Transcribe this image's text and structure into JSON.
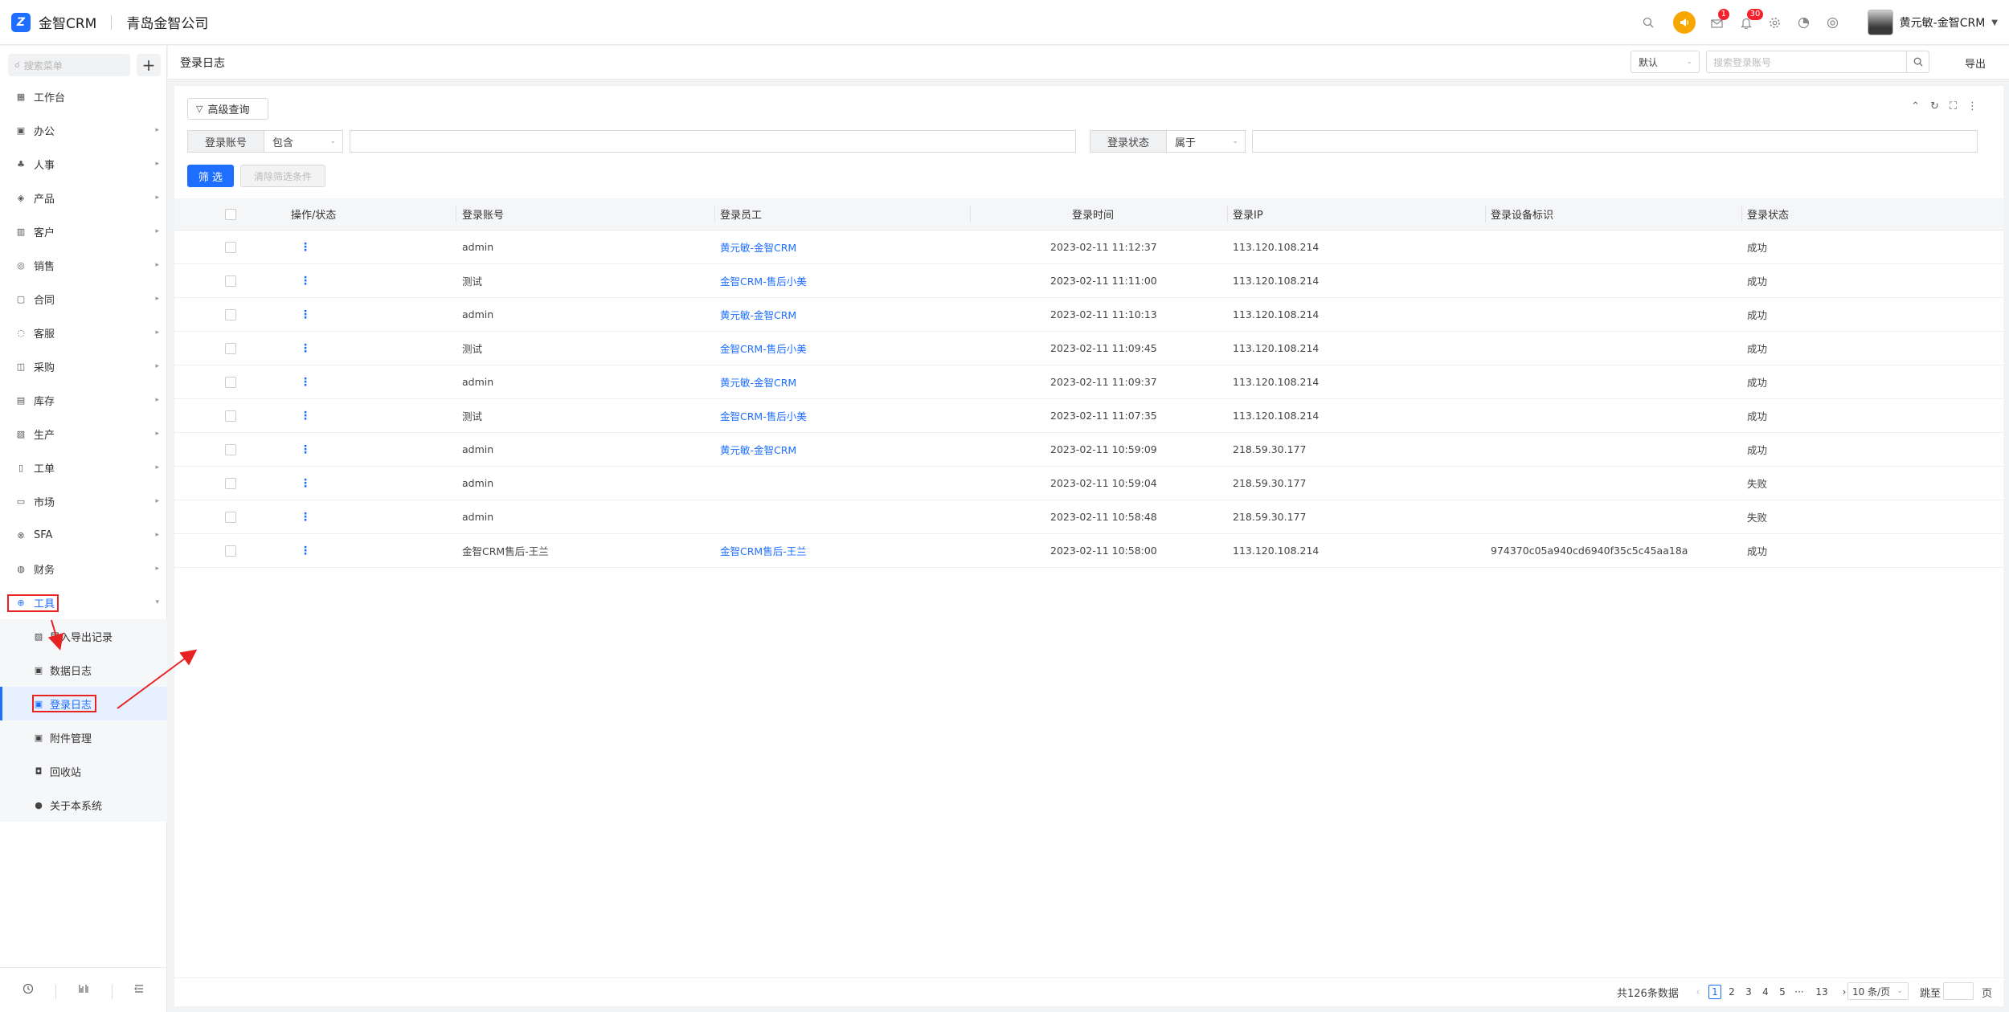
{
  "topbar": {
    "logo_glyph": "Z",
    "app_name": "金智CRM",
    "company": "青岛金智公司",
    "icons": [
      "search-icon",
      "speaker-icon",
      "mail-icon",
      "bell-icon",
      "gear-icon",
      "chart-icon",
      "help-icon"
    ],
    "mail_badge": "1",
    "bell_badge": "30",
    "user_name": "黄元敏-金智CRM"
  },
  "sidebar": {
    "search_placeholder": "搜索菜单",
    "add_label": "+",
    "items": [
      {
        "label": "工作台",
        "icon": "▦",
        "arrow": ""
      },
      {
        "label": "办公",
        "icon": "▣",
        "arrow": "▸"
      },
      {
        "label": "人事",
        "icon": "♣",
        "arrow": "▸"
      },
      {
        "label": "产品",
        "icon": "◈",
        "arrow": "▸"
      },
      {
        "label": "客户",
        "icon": "▥",
        "arrow": "▸"
      },
      {
        "label": "销售",
        "icon": "◎",
        "arrow": "▸"
      },
      {
        "label": "合同",
        "icon": "▢",
        "arrow": "▸"
      },
      {
        "label": "客服",
        "icon": "◌",
        "arrow": "▸"
      },
      {
        "label": "采购",
        "icon": "◫",
        "arrow": "▸"
      },
      {
        "label": "库存",
        "icon": "▤",
        "arrow": "▸"
      },
      {
        "label": "生产",
        "icon": "▧",
        "arrow": "▸"
      },
      {
        "label": "工单",
        "icon": "▯",
        "arrow": "▸"
      },
      {
        "label": "市场",
        "icon": "▭",
        "arrow": "▸"
      },
      {
        "label": "SFA",
        "icon": "⊗",
        "arrow": "▸"
      },
      {
        "label": "财务",
        "icon": "◍",
        "arrow": "▸"
      },
      {
        "label": "工具",
        "icon": "⊕",
        "arrow": "▾"
      }
    ],
    "sub_items": [
      {
        "label": "导入导出记录",
        "icon": "▨"
      },
      {
        "label": "数据日志",
        "icon": "▣"
      },
      {
        "label": "登录日志",
        "icon": "▣"
      },
      {
        "label": "附件管理",
        "icon": "▣"
      },
      {
        "label": "回收站",
        "icon": "◘"
      },
      {
        "label": "关于本系统",
        "icon": "●"
      }
    ],
    "bottom_icons": [
      "history-icon",
      "columns-icon",
      "collapse-menu-icon"
    ]
  },
  "page_head": {
    "title": "登录日志",
    "view_select": "默认",
    "search_placeholder": "搜索登录账号",
    "export_label": "导出"
  },
  "filters": {
    "advanced_label": "高级查询",
    "account_label": "登录账号",
    "account_op": "包含",
    "account_value": "",
    "status_label": "登录状态",
    "status_op": "属于",
    "status_value": "",
    "filter_btn": "筛 选",
    "clear_btn": "清除筛选条件",
    "tool_icons": [
      "collapse-icon",
      "refresh-icon",
      "fullscreen-icon",
      "more-icon"
    ]
  },
  "table": {
    "columns": [
      "操作/状态",
      "登录账号",
      "登录员工",
      "登录时间",
      "登录IP",
      "登录设备标识",
      "登录状态"
    ],
    "rows": [
      {
        "account": "admin",
        "employee": "黄元敏-金智CRM",
        "time": "2023-02-11 11:12:37",
        "ip": "113.120.108.214",
        "device": "",
        "status": "成功"
      },
      {
        "account": "测试",
        "employee": "金智CRM-售后小美",
        "time": "2023-02-11 11:11:00",
        "ip": "113.120.108.214",
        "device": "",
        "status": "成功"
      },
      {
        "account": "admin",
        "employee": "黄元敏-金智CRM",
        "time": "2023-02-11 11:10:13",
        "ip": "113.120.108.214",
        "device": "",
        "status": "成功"
      },
      {
        "account": "测试",
        "employee": "金智CRM-售后小美",
        "time": "2023-02-11 11:09:45",
        "ip": "113.120.108.214",
        "device": "",
        "status": "成功"
      },
      {
        "account": "admin",
        "employee": "黄元敏-金智CRM",
        "time": "2023-02-11 11:09:37",
        "ip": "113.120.108.214",
        "device": "",
        "status": "成功"
      },
      {
        "account": "测试",
        "employee": "金智CRM-售后小美",
        "time": "2023-02-11 11:07:35",
        "ip": "113.120.108.214",
        "device": "",
        "status": "成功"
      },
      {
        "account": "admin",
        "employee": "黄元敏-金智CRM",
        "time": "2023-02-11 10:59:09",
        "ip": "218.59.30.177",
        "device": "",
        "status": "成功"
      },
      {
        "account": "admin",
        "employee": "",
        "time": "2023-02-11 10:59:04",
        "ip": "218.59.30.177",
        "device": "",
        "status": "失败"
      },
      {
        "account": "admin",
        "employee": "",
        "time": "2023-02-11 10:58:48",
        "ip": "218.59.30.177",
        "device": "",
        "status": "失败"
      },
      {
        "account": "金智CRM售后-王兰",
        "employee": "金智CRM售后-王兰",
        "time": "2023-02-11 10:58:00",
        "ip": "113.120.108.214",
        "device": "974370c05a940cd6940f35c5c45aa18a",
        "status": "成功"
      }
    ],
    "op_glyph": "⋮"
  },
  "pagination": {
    "total": "共126条数据",
    "prev": "‹",
    "pages": [
      "1",
      "2",
      "3",
      "4",
      "5",
      "···",
      "13"
    ],
    "current": "1",
    "next": "›",
    "page_size": "10 条/页",
    "jump_label": "跳至",
    "page_label": "页"
  },
  "colors": {
    "accent": "#1e6fff",
    "annotation": "#e82222",
    "badge": "#f5222d",
    "speaker": "#f6a700"
  }
}
